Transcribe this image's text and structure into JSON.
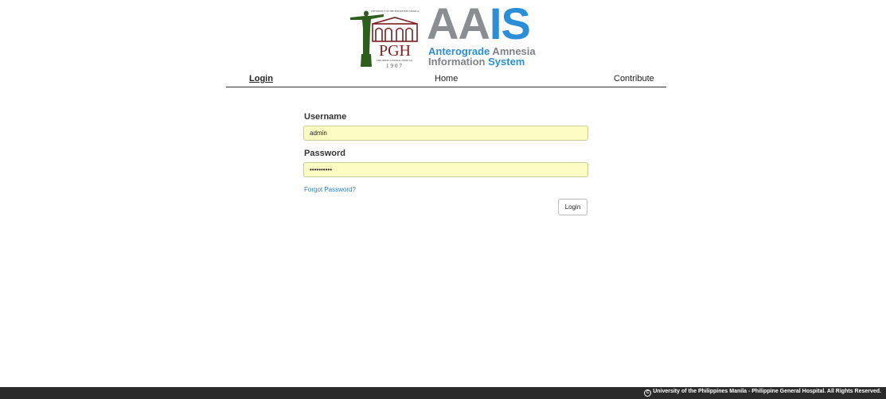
{
  "header": {
    "pgh_logo": {
      "top_text": "UNIVERSITY OF THE PHILIPPINES MANILA",
      "initials": "PGH",
      "bottom_text": "PHILIPPINE GENERAL HOSPITAL",
      "year": "1907",
      "colors": {
        "maroon": "#7b1f1f",
        "green": "#2e5e1e"
      }
    },
    "brand": {
      "aa": "AA",
      "is": "IS",
      "line1_blue": "Anterograde",
      "line1_grey": " Amnesia",
      "line2_grey": "Information ",
      "line2_blue": "System",
      "colors": {
        "grey": "#8a8d91",
        "blue": "#2a8fd6"
      }
    }
  },
  "nav": {
    "login": "Login",
    "home": "Home",
    "contribute": "Contribute"
  },
  "form": {
    "username_label": "Username",
    "username_value": "admin",
    "password_label": "Password",
    "password_value": "••••••••••",
    "forgot_password": "Forgot Password?",
    "login_button": "Login",
    "input_bg_color": "#fbfdc2"
  },
  "footer": {
    "copyright_icon": "copyright-icon",
    "text": "University of the Philippines Manila - Philippine General Hospital. All Rights Reserved."
  }
}
